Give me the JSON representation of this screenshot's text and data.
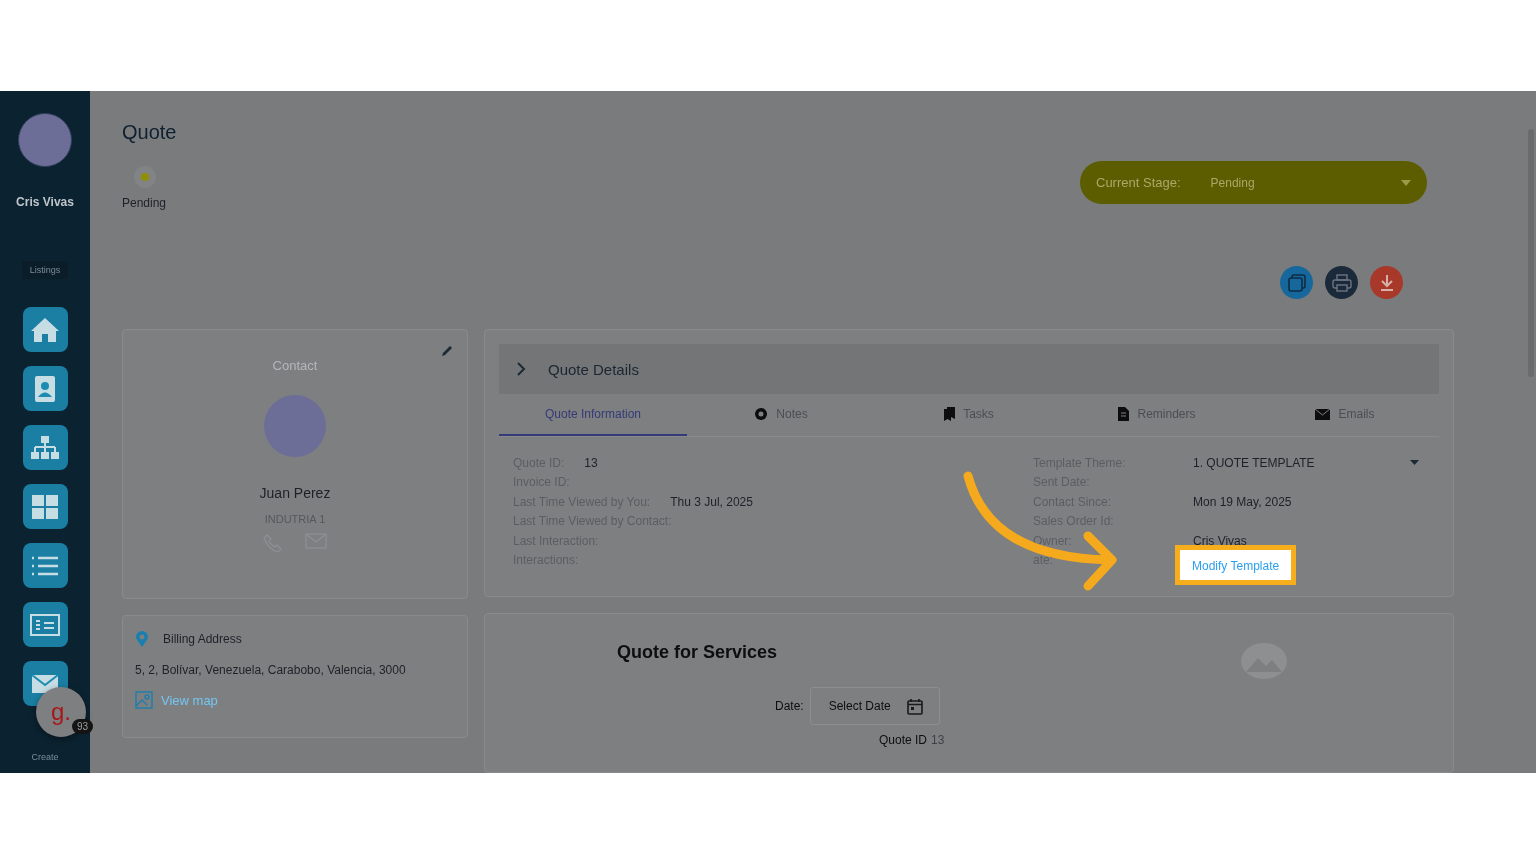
{
  "sidebar": {
    "user_name": "Cris Vivas",
    "section_label": "Listings",
    "footer_label": "Create",
    "nav_items": [
      {
        "kind": "home"
      },
      {
        "kind": "contact"
      },
      {
        "kind": "hierarchy"
      },
      {
        "kind": "grid"
      },
      {
        "kind": "list"
      },
      {
        "kind": "invoice"
      },
      {
        "kind": "mail"
      }
    ]
  },
  "help_badge": {
    "letter": "g.",
    "count": "93"
  },
  "page": {
    "title": "Quote",
    "status": "Pending"
  },
  "stage_select": {
    "label": "Current Stage:",
    "value": "Pending"
  },
  "actions": [
    {
      "kind": "copy"
    },
    {
      "kind": "print"
    },
    {
      "kind": "download"
    }
  ],
  "contact_card": {
    "heading": "Contact",
    "name": "Juan Perez",
    "company": "INDUTRIA 1"
  },
  "billing": {
    "heading": "Billing Address",
    "address": "5, 2, Bolívar, Venezuela, Carabobo, Valencia, 3000",
    "map_link": "View map"
  },
  "quote_details": {
    "title": "Quote Details",
    "tabs": [
      {
        "label": "Quote Information",
        "kind": "info",
        "selected": true
      },
      {
        "label": "Notes",
        "kind": "notes",
        "selected": false
      },
      {
        "label": "Tasks",
        "kind": "tasks",
        "selected": false
      },
      {
        "label": "Reminders",
        "kind": "reminders",
        "selected": false
      },
      {
        "label": "Emails",
        "kind": "emails",
        "selected": false
      }
    ],
    "left_fields": [
      {
        "label": "Quote ID:",
        "value": "13"
      },
      {
        "label": "Invoice ID:"
      },
      {
        "label": "Last Time Viewed by You:",
        "value": "Thu 3 Jul, 2025"
      },
      {
        "label": "Last Time Viewed by Contact:"
      },
      {
        "label": "Last Interaction:"
      },
      {
        "label": "Interactions:"
      }
    ],
    "right_fields": [
      {
        "label": "Template Theme:",
        "kind": "select",
        "value": "1. QUOTE TEMPLATE"
      },
      {
        "label": "Sent Date:",
        "kind": "text"
      },
      {
        "label": "Contact Since:",
        "kind": "text",
        "value": "Mon 19 May, 2025"
      },
      {
        "label": "Sales Order Id:",
        "kind": "text"
      },
      {
        "label": "Owner:",
        "kind": "text",
        "value": "Cris Vivas"
      },
      {
        "label": "ate:",
        "kind": "link",
        "value": "Modify Template"
      }
    ]
  },
  "preview": {
    "title": "Quote for Services",
    "date_label": "Date:",
    "date_placeholder": "Select Date",
    "quote_id_label": "Quote ID",
    "quote_id": "13"
  }
}
